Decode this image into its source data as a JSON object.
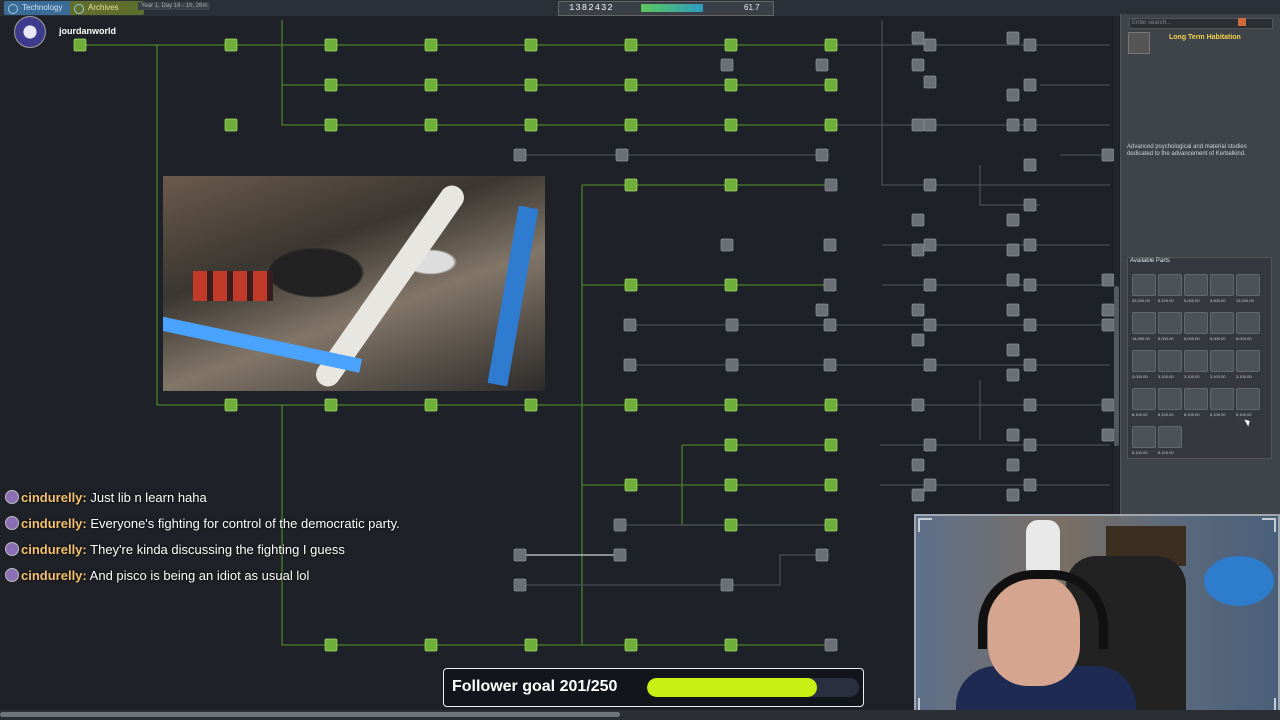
{
  "topbar": {
    "tab_technology": "Technology",
    "tab_archives": "Archives",
    "date": "Year 1, Day 16 - 1h, 26m",
    "funds": "1382432",
    "science": "61.7"
  },
  "stream": {
    "channel": "jourdanworld"
  },
  "right_panel": {
    "search_placeholder": "Enter search...",
    "node_title": "Long Term Habitation",
    "node_description": "Advanced psychological and material studies dedicated to the advancement of Kerbalkind.",
    "parts_title": "Available Parts",
    "parts": [
      {
        "price": "25,000.00"
      },
      {
        "price": "6,100.00"
      },
      {
        "price": "5,000.00"
      },
      {
        "price": "5,600.00"
      },
      {
        "price": "15,000.00"
      },
      {
        "price": "14,000.00"
      },
      {
        "price": "8,000.00"
      },
      {
        "price": "8,000.00"
      },
      {
        "price": "8,000.00"
      },
      {
        "price": "8,000.00"
      },
      {
        "price": "3,000.00"
      },
      {
        "price": "3,100.00"
      },
      {
        "price": "3,100.00"
      },
      {
        "price": "3,100.00"
      },
      {
        "price": "3,100.00"
      },
      {
        "price": "8,100.00"
      },
      {
        "price": "8,100.00"
      },
      {
        "price": "8,100.00"
      },
      {
        "price": "8,100.00"
      },
      {
        "price": "8,100.00"
      },
      {
        "price": "8,100.00"
      },
      {
        "price": "8,100.00"
      }
    ]
  },
  "chat": [
    {
      "user": "cindurelly",
      "text": "Just lib n learn haha"
    },
    {
      "user": "cindurelly",
      "text": "Everyone's fighting for control of the democratic party."
    },
    {
      "user": "cindurelly",
      "text": "They're kinda discussing the fighting I guess"
    },
    {
      "user": "cindurelly",
      "text": "And pisco is being an idiot as usual lol"
    }
  ],
  "follower_goal": {
    "label": "Follower goal 201/250",
    "current": 201,
    "target": 250
  },
  "colors": {
    "node_researched": "#6fae3a",
    "node_locked": "#6b7077",
    "line_researched": "#4d7f2a",
    "line_locked": "#4a4e55",
    "goal_fill": "#c9ef14"
  }
}
